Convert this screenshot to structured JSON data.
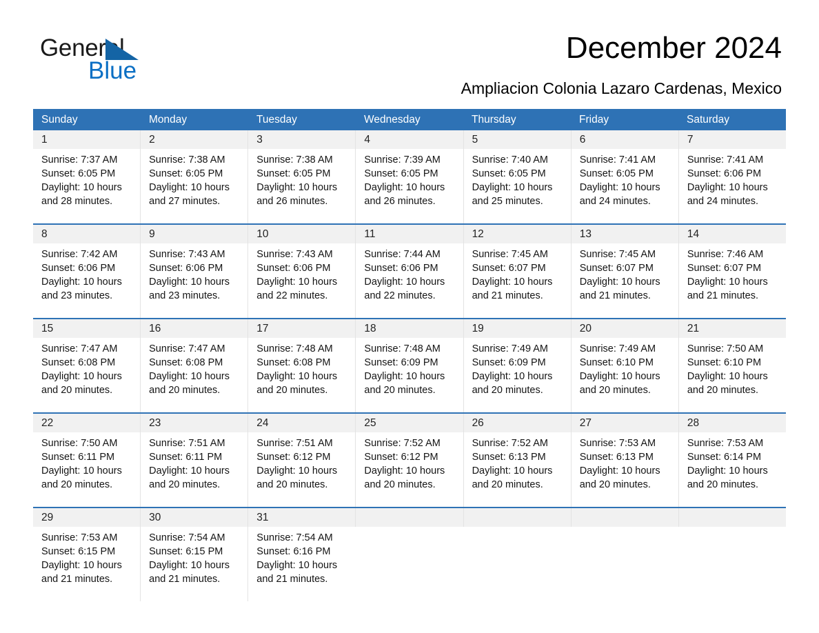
{
  "brand": {
    "name_part1": "General",
    "name_part2": "Blue",
    "triangle_color": "#1464A5",
    "blue_text_color": "#0B6FC4"
  },
  "header": {
    "title": "December 2024",
    "subtitle": "Ampliacion Colonia Lazaro Cardenas, Mexico"
  },
  "colors": {
    "header_bar": "#2E72B5",
    "date_band": "#F1F1F1",
    "week_divider": "#2E72B5",
    "cell_divider": "#E3E3E3"
  },
  "calendar": {
    "day_headers": [
      "Sunday",
      "Monday",
      "Tuesday",
      "Wednesday",
      "Thursday",
      "Friday",
      "Saturday"
    ],
    "weeks": [
      {
        "days": [
          {
            "date": "1",
            "sunrise": "Sunrise: 7:37 AM",
            "sunset": "Sunset: 6:05 PM",
            "daylight_1": "Daylight: 10 hours",
            "daylight_2": "and 28 minutes."
          },
          {
            "date": "2",
            "sunrise": "Sunrise: 7:38 AM",
            "sunset": "Sunset: 6:05 PM",
            "daylight_1": "Daylight: 10 hours",
            "daylight_2": "and 27 minutes."
          },
          {
            "date": "3",
            "sunrise": "Sunrise: 7:38 AM",
            "sunset": "Sunset: 6:05 PM",
            "daylight_1": "Daylight: 10 hours",
            "daylight_2": "and 26 minutes."
          },
          {
            "date": "4",
            "sunrise": "Sunrise: 7:39 AM",
            "sunset": "Sunset: 6:05 PM",
            "daylight_1": "Daylight: 10 hours",
            "daylight_2": "and 26 minutes."
          },
          {
            "date": "5",
            "sunrise": "Sunrise: 7:40 AM",
            "sunset": "Sunset: 6:05 PM",
            "daylight_1": "Daylight: 10 hours",
            "daylight_2": "and 25 minutes."
          },
          {
            "date": "6",
            "sunrise": "Sunrise: 7:41 AM",
            "sunset": "Sunset: 6:05 PM",
            "daylight_1": "Daylight: 10 hours",
            "daylight_2": "and 24 minutes."
          },
          {
            "date": "7",
            "sunrise": "Sunrise: 7:41 AM",
            "sunset": "Sunset: 6:06 PM",
            "daylight_1": "Daylight: 10 hours",
            "daylight_2": "and 24 minutes."
          }
        ]
      },
      {
        "days": [
          {
            "date": "8",
            "sunrise": "Sunrise: 7:42 AM",
            "sunset": "Sunset: 6:06 PM",
            "daylight_1": "Daylight: 10 hours",
            "daylight_2": "and 23 minutes."
          },
          {
            "date": "9",
            "sunrise": "Sunrise: 7:43 AM",
            "sunset": "Sunset: 6:06 PM",
            "daylight_1": "Daylight: 10 hours",
            "daylight_2": "and 23 minutes."
          },
          {
            "date": "10",
            "sunrise": "Sunrise: 7:43 AM",
            "sunset": "Sunset: 6:06 PM",
            "daylight_1": "Daylight: 10 hours",
            "daylight_2": "and 22 minutes."
          },
          {
            "date": "11",
            "sunrise": "Sunrise: 7:44 AM",
            "sunset": "Sunset: 6:06 PM",
            "daylight_1": "Daylight: 10 hours",
            "daylight_2": "and 22 minutes."
          },
          {
            "date": "12",
            "sunrise": "Sunrise: 7:45 AM",
            "sunset": "Sunset: 6:07 PM",
            "daylight_1": "Daylight: 10 hours",
            "daylight_2": "and 21 minutes."
          },
          {
            "date": "13",
            "sunrise": "Sunrise: 7:45 AM",
            "sunset": "Sunset: 6:07 PM",
            "daylight_1": "Daylight: 10 hours",
            "daylight_2": "and 21 minutes."
          },
          {
            "date": "14",
            "sunrise": "Sunrise: 7:46 AM",
            "sunset": "Sunset: 6:07 PM",
            "daylight_1": "Daylight: 10 hours",
            "daylight_2": "and 21 minutes."
          }
        ]
      },
      {
        "days": [
          {
            "date": "15",
            "sunrise": "Sunrise: 7:47 AM",
            "sunset": "Sunset: 6:08 PM",
            "daylight_1": "Daylight: 10 hours",
            "daylight_2": "and 20 minutes."
          },
          {
            "date": "16",
            "sunrise": "Sunrise: 7:47 AM",
            "sunset": "Sunset: 6:08 PM",
            "daylight_1": "Daylight: 10 hours",
            "daylight_2": "and 20 minutes."
          },
          {
            "date": "17",
            "sunrise": "Sunrise: 7:48 AM",
            "sunset": "Sunset: 6:08 PM",
            "daylight_1": "Daylight: 10 hours",
            "daylight_2": "and 20 minutes."
          },
          {
            "date": "18",
            "sunrise": "Sunrise: 7:48 AM",
            "sunset": "Sunset: 6:09 PM",
            "daylight_1": "Daylight: 10 hours",
            "daylight_2": "and 20 minutes."
          },
          {
            "date": "19",
            "sunrise": "Sunrise: 7:49 AM",
            "sunset": "Sunset: 6:09 PM",
            "daylight_1": "Daylight: 10 hours",
            "daylight_2": "and 20 minutes."
          },
          {
            "date": "20",
            "sunrise": "Sunrise: 7:49 AM",
            "sunset": "Sunset: 6:10 PM",
            "daylight_1": "Daylight: 10 hours",
            "daylight_2": "and 20 minutes."
          },
          {
            "date": "21",
            "sunrise": "Sunrise: 7:50 AM",
            "sunset": "Sunset: 6:10 PM",
            "daylight_1": "Daylight: 10 hours",
            "daylight_2": "and 20 minutes."
          }
        ]
      },
      {
        "days": [
          {
            "date": "22",
            "sunrise": "Sunrise: 7:50 AM",
            "sunset": "Sunset: 6:11 PM",
            "daylight_1": "Daylight: 10 hours",
            "daylight_2": "and 20 minutes."
          },
          {
            "date": "23",
            "sunrise": "Sunrise: 7:51 AM",
            "sunset": "Sunset: 6:11 PM",
            "daylight_1": "Daylight: 10 hours",
            "daylight_2": "and 20 minutes."
          },
          {
            "date": "24",
            "sunrise": "Sunrise: 7:51 AM",
            "sunset": "Sunset: 6:12 PM",
            "daylight_1": "Daylight: 10 hours",
            "daylight_2": "and 20 minutes."
          },
          {
            "date": "25",
            "sunrise": "Sunrise: 7:52 AM",
            "sunset": "Sunset: 6:12 PM",
            "daylight_1": "Daylight: 10 hours",
            "daylight_2": "and 20 minutes."
          },
          {
            "date": "26",
            "sunrise": "Sunrise: 7:52 AM",
            "sunset": "Sunset: 6:13 PM",
            "daylight_1": "Daylight: 10 hours",
            "daylight_2": "and 20 minutes."
          },
          {
            "date": "27",
            "sunrise": "Sunrise: 7:53 AM",
            "sunset": "Sunset: 6:13 PM",
            "daylight_1": "Daylight: 10 hours",
            "daylight_2": "and 20 minutes."
          },
          {
            "date": "28",
            "sunrise": "Sunrise: 7:53 AM",
            "sunset": "Sunset: 6:14 PM",
            "daylight_1": "Daylight: 10 hours",
            "daylight_2": "and 20 minutes."
          }
        ]
      },
      {
        "days": [
          {
            "date": "29",
            "sunrise": "Sunrise: 7:53 AM",
            "sunset": "Sunset: 6:15 PM",
            "daylight_1": "Daylight: 10 hours",
            "daylight_2": "and 21 minutes."
          },
          {
            "date": "30",
            "sunrise": "Sunrise: 7:54 AM",
            "sunset": "Sunset: 6:15 PM",
            "daylight_1": "Daylight: 10 hours",
            "daylight_2": "and 21 minutes."
          },
          {
            "date": "31",
            "sunrise": "Sunrise: 7:54 AM",
            "sunset": "Sunset: 6:16 PM",
            "daylight_1": "Daylight: 10 hours",
            "daylight_2": "and 21 minutes."
          },
          {
            "date": "",
            "sunrise": "",
            "sunset": "",
            "daylight_1": "",
            "daylight_2": ""
          },
          {
            "date": "",
            "sunrise": "",
            "sunset": "",
            "daylight_1": "",
            "daylight_2": ""
          },
          {
            "date": "",
            "sunrise": "",
            "sunset": "",
            "daylight_1": "",
            "daylight_2": ""
          },
          {
            "date": "",
            "sunrise": "",
            "sunset": "",
            "daylight_1": "",
            "daylight_2": ""
          }
        ]
      }
    ]
  }
}
